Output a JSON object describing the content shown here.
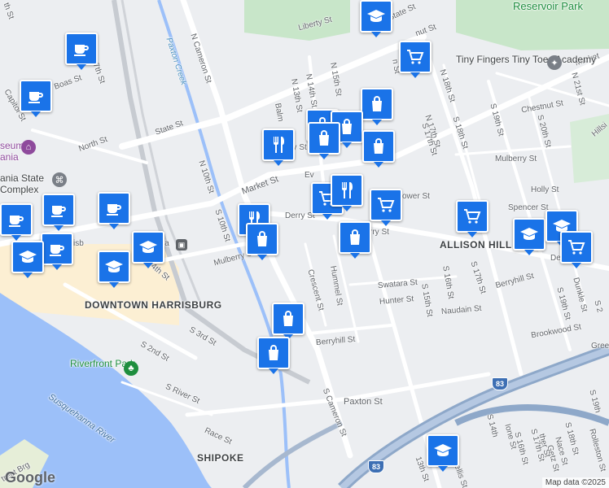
{
  "map": {
    "streets": [
      {
        "id": "liberty-st",
        "text": "Liberty St"
      },
      {
        "id": "state-st-top",
        "text": "State St"
      },
      {
        "id": "n-cameron-st",
        "text": "N Cameron St"
      },
      {
        "id": "paxton-creek",
        "text": "Paxton Creek"
      },
      {
        "id": "boas-st",
        "text": "Boas St"
      },
      {
        "id": "n-7th-st",
        "text": "7th St"
      },
      {
        "id": "capitol-st",
        "text": "Capitol St"
      },
      {
        "id": "north-st",
        "text": "North St"
      },
      {
        "id": "state-st",
        "text": "State St"
      },
      {
        "id": "n-15th-st",
        "text": "N 15th St"
      },
      {
        "id": "n-14th-st",
        "text": "N 14th St"
      },
      {
        "id": "n-13th-st",
        "text": "N 13th St"
      },
      {
        "id": "balm",
        "text": "Balm"
      },
      {
        "id": "n-16th-st",
        "text": "n St"
      },
      {
        "id": "n-17th-st",
        "text": "N 17th St"
      },
      {
        "id": "n-18th-st",
        "text": "N 18th St"
      },
      {
        "id": "market-st-east",
        "text": "Market"
      },
      {
        "id": "n-21st-st",
        "text": "N 21st St"
      },
      {
        "id": "chestnut-st",
        "text": "Chestnut St"
      },
      {
        "id": "s-19th-st-top",
        "text": "S 19th St"
      },
      {
        "id": "s-20th-st",
        "text": "S 20th St"
      },
      {
        "id": "s-17th-st-top",
        "text": "S 17th St"
      },
      {
        "id": "s-18th-st-top",
        "text": "S 18th St"
      },
      {
        "id": "hillside",
        "text": "Hillsi"
      },
      {
        "id": "mulberry-st-east",
        "text": "Mulberry St"
      },
      {
        "id": "holly-st",
        "text": "Holly St"
      },
      {
        "id": "spencer-st",
        "text": "Spencer St"
      },
      {
        "id": "mayflower-st",
        "text": "yflower St"
      },
      {
        "id": "market-st",
        "text": "Market St"
      },
      {
        "id": "n-10th-st",
        "text": "N 10th St"
      },
      {
        "id": "s-10th-st",
        "text": "S 10th St"
      },
      {
        "id": "derry-st",
        "text": "Derry St"
      },
      {
        "id": "derry-st-2",
        "text": "rry St"
      },
      {
        "id": "derry-st-3",
        "text": "Derry St"
      },
      {
        "id": "mulberry-st",
        "text": "Mulberry St"
      },
      {
        "id": "4th-st",
        "text": "4th St"
      },
      {
        "id": "berryhill-st",
        "text": "Berryhill St"
      },
      {
        "id": "dunkle-st",
        "text": "Dunkle St"
      },
      {
        "id": "s-19th-st",
        "text": "S 19th St"
      },
      {
        "id": "brookwood-st",
        "text": "Brookwood St"
      },
      {
        "id": "green",
        "text": "Gree"
      },
      {
        "id": "s-17th-st",
        "text": "S 17th St"
      },
      {
        "id": "s-16th-st",
        "text": "S 16th St"
      },
      {
        "id": "s-15th-st",
        "text": "S 15th St"
      },
      {
        "id": "swatara-st",
        "text": "Swatara St"
      },
      {
        "id": "hunter-st",
        "text": "Hunter St"
      },
      {
        "id": "naudain-st",
        "text": "Naudain St"
      },
      {
        "id": "hummel-st",
        "text": "Hummel St"
      },
      {
        "id": "crescent-st",
        "text": "Crescent St"
      },
      {
        "id": "berryhill-st-2",
        "text": "Berryhill St"
      },
      {
        "id": "s-3rd-st",
        "text": "S 3rd St"
      },
      {
        "id": "s-2nd-st",
        "text": "S 2nd St"
      },
      {
        "id": "s-river-st",
        "text": "S River St"
      },
      {
        "id": "paxton-st",
        "text": "Paxton St"
      },
      {
        "id": "s-cameron-st",
        "text": "S Cameron St"
      },
      {
        "id": "race-st",
        "text": "Race St"
      },
      {
        "id": "s-13th-st",
        "text": "13th St"
      },
      {
        "id": "ione-st",
        "text": "Ione St"
      },
      {
        "id": "s-16th-st-2",
        "text": "S 16th St"
      },
      {
        "id": "s-17th-st-2",
        "text": "S 17th St"
      },
      {
        "id": "nace-st",
        "text": "Nace St"
      },
      {
        "id": "getz-st",
        "text": "Getz St"
      },
      {
        "id": "s-18th-st-2",
        "text": "S 18th St"
      },
      {
        "id": "ther-st",
        "text": "ther St"
      },
      {
        "id": "rolleston",
        "text": "Rolleston St"
      },
      {
        "id": "s-14th-st",
        "text": "S 14th"
      },
      {
        "id": "s-19th-st-2",
        "text": "S 19th"
      },
      {
        "id": "ellis-st",
        "text": "ellis St"
      },
      {
        "id": "s-21st-frag",
        "text": "S 2"
      },
      {
        "id": "nut-st",
        "text": "nut St"
      },
      {
        "id": "ey-st",
        "text": "ey St"
      },
      {
        "id": "ev",
        "text": "Ev"
      },
      {
        "id": "isb",
        "text": "isb"
      },
      {
        "id": "ia",
        "text": "ia"
      },
      {
        "id": "frag-th",
        "text": "th St"
      },
      {
        "id": "street-brg",
        "text": "treet Brg"
      }
    ],
    "places": {
      "reservoir_park": "Reservoir Park",
      "tiny_fingers": "Tiny Fingers Tiny Toes Academy",
      "allison_hill": "ALLISON HILL",
      "downtown": "DOWNTOWN HARRISBURG",
      "riverfront_park": "Riverfront Park",
      "susquehanna": "Susquehanna River",
      "shipoke": "SHIPOKE",
      "museum": "seum",
      "museum2": "ania",
      "state_complex": "ania State",
      "state_complex2": "Complex",
      "highway_83": "83",
      "highway_83b": "83"
    },
    "footer": {
      "logo": "Google",
      "credit": "Map data ©2025"
    },
    "pins": [
      {
        "icon": "school-icon"
      },
      {
        "icon": "coffee-icon"
      },
      {
        "icon": "coffee-icon"
      },
      {
        "icon": "cart-icon"
      },
      {
        "icon": "bag-icon"
      },
      {
        "icon": "restaurant-icon"
      },
      {
        "icon": "bag-icon"
      },
      {
        "icon": "bag-icon"
      },
      {
        "icon": "bag-icon"
      },
      {
        "icon": "bag-icon"
      },
      {
        "icon": "coffee-icon"
      },
      {
        "icon": "coffee-icon"
      },
      {
        "icon": "coffee-icon"
      },
      {
        "icon": "coffee-icon"
      },
      {
        "icon": "school-icon"
      },
      {
        "icon": "school-icon"
      },
      {
        "icon": "school-icon"
      },
      {
        "icon": "restaurant-icon"
      },
      {
        "icon": "bag-icon"
      },
      {
        "icon": "cart-icon"
      },
      {
        "icon": "restaurant-icon"
      },
      {
        "icon": "cart-icon"
      },
      {
        "icon": "bag-icon"
      },
      {
        "icon": "cart-icon"
      },
      {
        "icon": "school-icon"
      },
      {
        "icon": "school-icon"
      },
      {
        "icon": "cart-icon"
      },
      {
        "icon": "bag-icon"
      },
      {
        "icon": "bag-icon"
      },
      {
        "icon": "school-icon"
      }
    ]
  },
  "colors": {
    "marker": "#1a73e8",
    "water": "#9cc0f9",
    "park": "#c8e6c9",
    "highway": "#8ea8c9",
    "downtown_tint": "#fcefd3"
  }
}
